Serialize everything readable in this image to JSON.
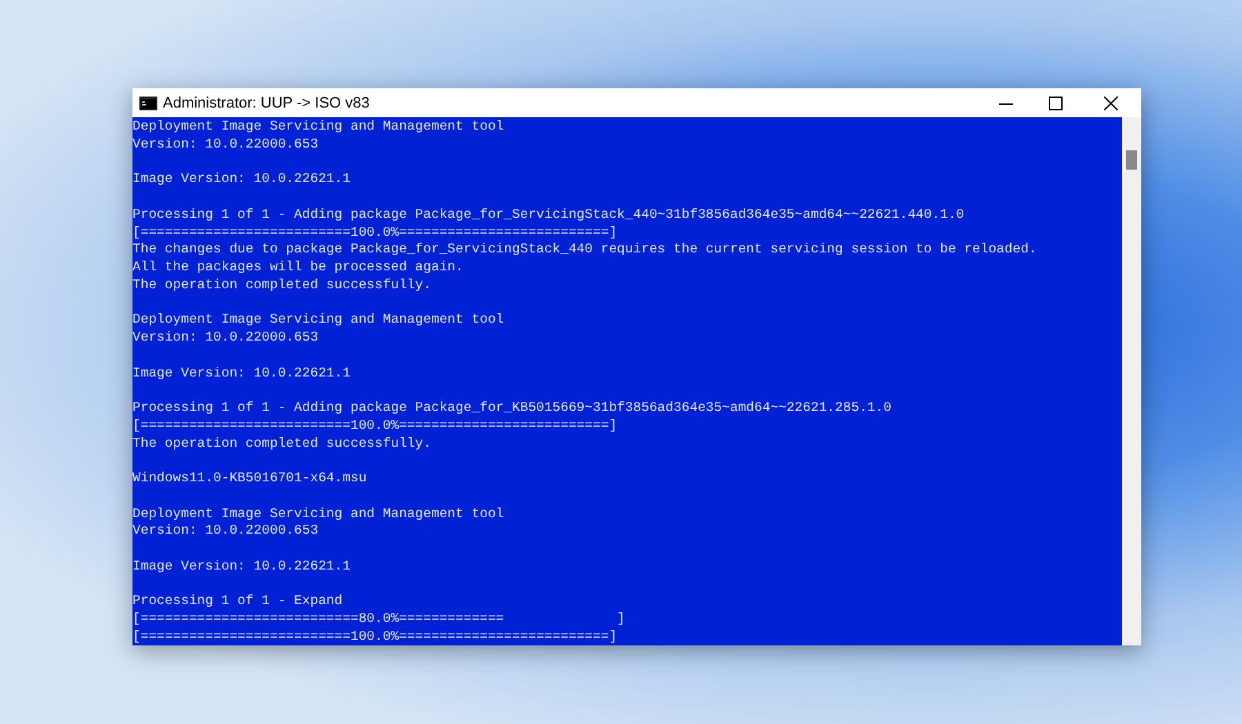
{
  "window": {
    "title": "Administrator:  UUP -> ISO v83"
  },
  "console": {
    "blocks": [
      [
        "Deployment Image Servicing and Management tool",
        "Version: 10.0.22000.653"
      ],
      [
        "Image Version: 10.0.22621.1"
      ],
      [
        "Processing 1 of 1 - Adding package Package_for_ServicingStack_440~31bf3856ad364e35~amd64~~22621.440.1.0",
        "[==========================100.0%==========================]",
        "The changes due to package Package_for_ServicingStack_440 requires the current servicing session to be reloaded.",
        "All the packages will be processed again.",
        "The operation completed successfully."
      ],
      [
        "Deployment Image Servicing and Management tool",
        "Version: 10.0.22000.653"
      ],
      [
        "Image Version: 10.0.22621.1"
      ],
      [
        "Processing 1 of 1 - Adding package Package_for_KB5015669~31bf3856ad364e35~amd64~~22621.285.1.0",
        "[==========================100.0%==========================]",
        "The operation completed successfully."
      ],
      [
        "Windows11.0-KB5016701-x64.msu"
      ],
      [
        "Deployment Image Servicing and Management tool",
        "Version: 10.0.22000.653"
      ],
      [
        "Image Version: 10.0.22621.1"
      ],
      [
        "Processing 1 of 1 - Expand",
        "[===========================80.0%=============              ]",
        "[==========================100.0%==========================]"
      ]
    ]
  }
}
